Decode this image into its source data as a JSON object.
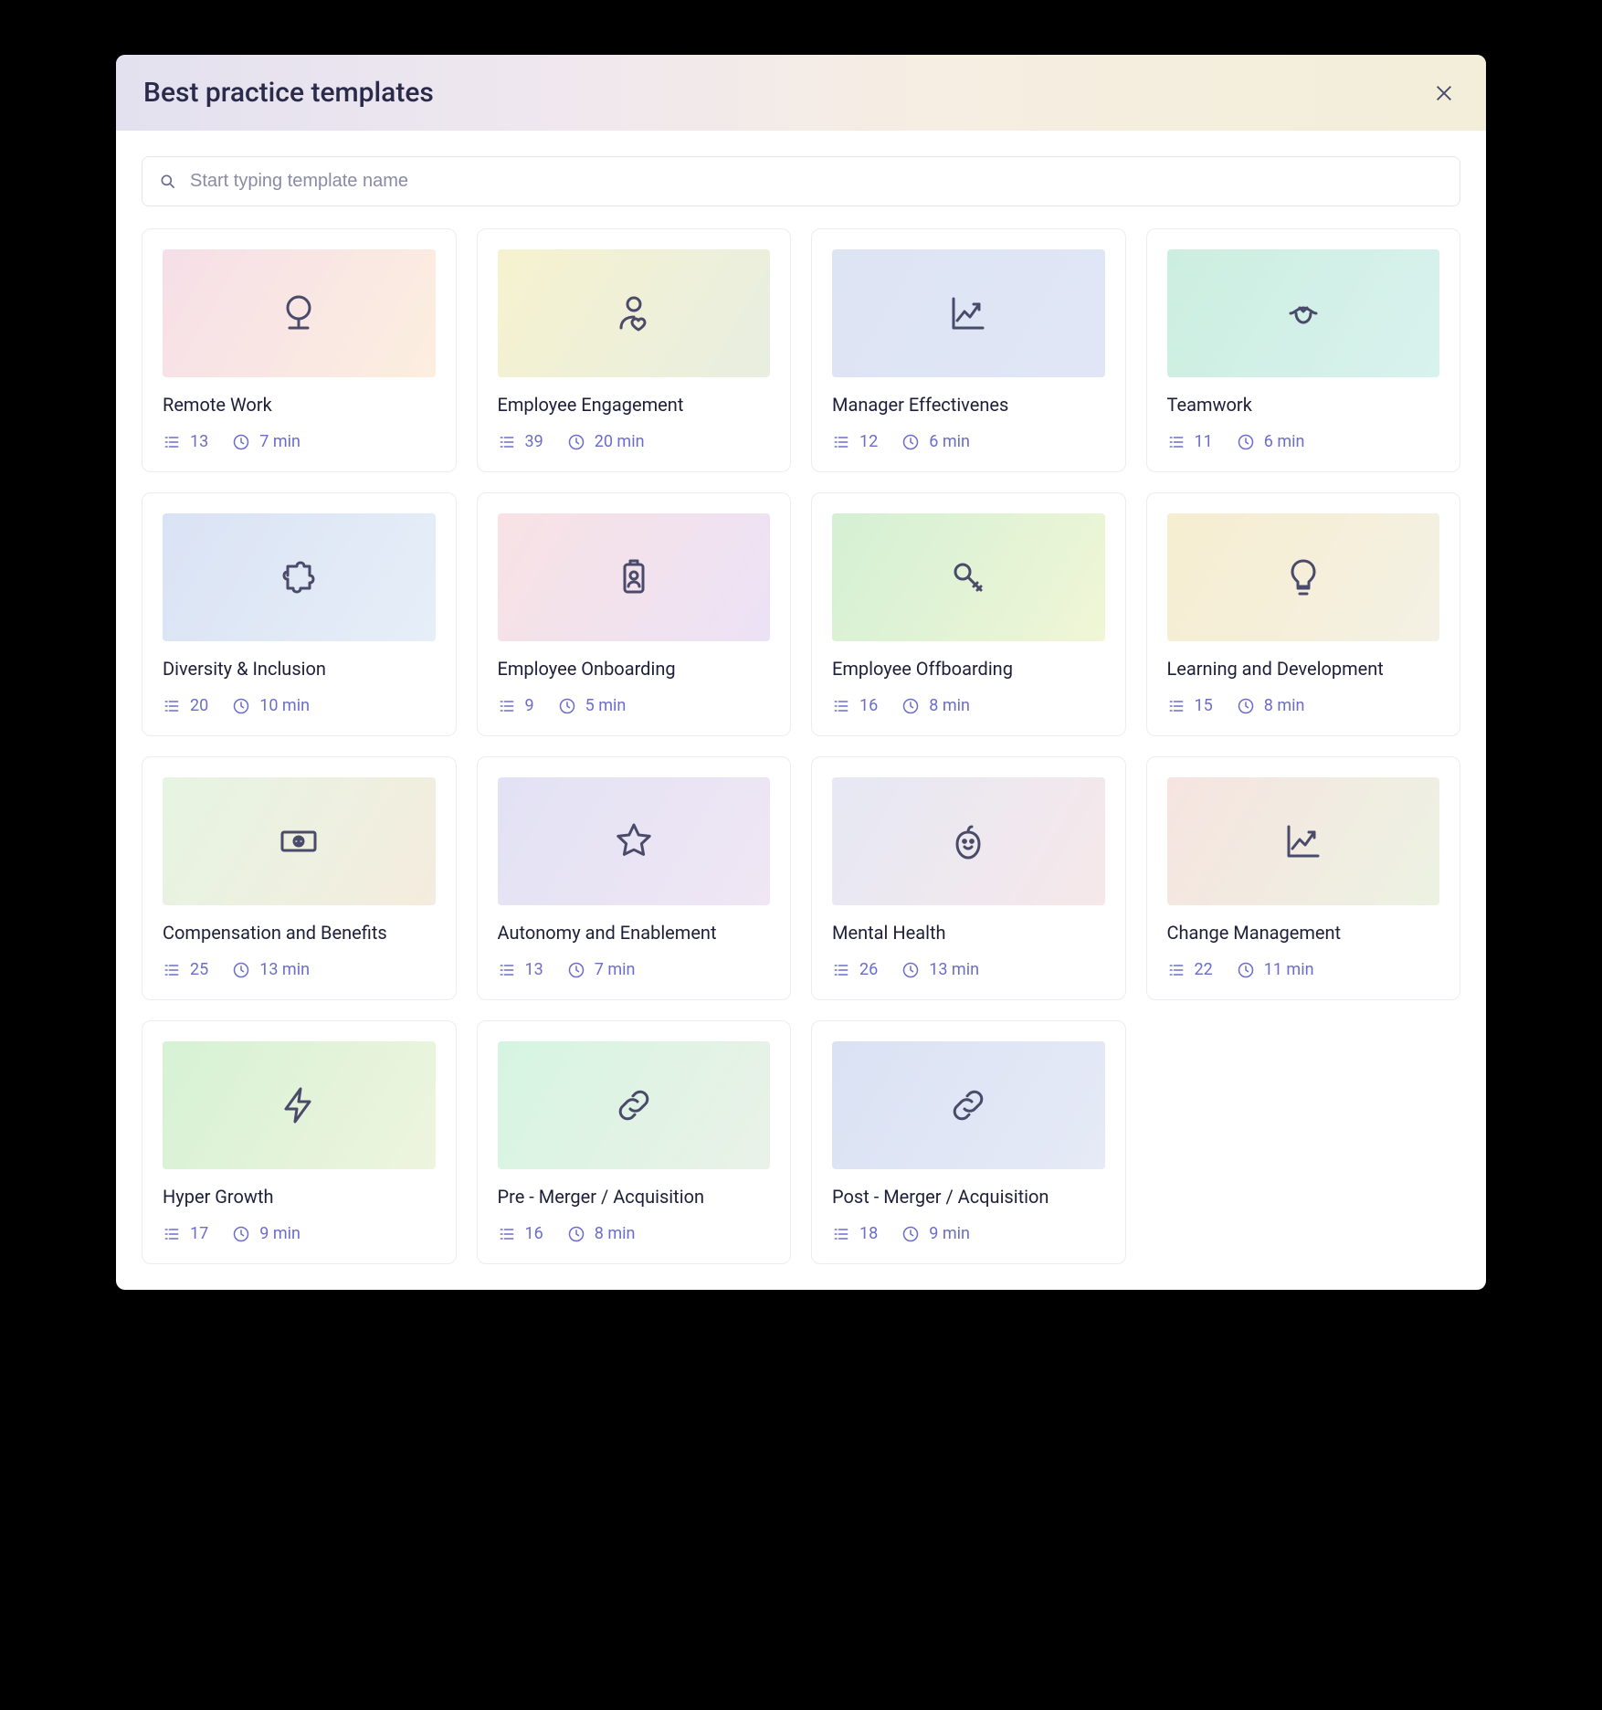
{
  "modal": {
    "title": "Best practice templates"
  },
  "search": {
    "placeholder": "Start typing template name",
    "value": ""
  },
  "templates": [
    {
      "title": "Remote Work",
      "questions": "13",
      "duration": "7 min",
      "icon": "globe-stand-icon",
      "gradient": "g0"
    },
    {
      "title": "Employee Engagement",
      "questions": "39",
      "duration": "20 min",
      "icon": "person-heart-icon",
      "gradient": "g1"
    },
    {
      "title": "Manager Effectivenes",
      "questions": "12",
      "duration": "6 min",
      "icon": "growth-chart-icon",
      "gradient": "g2"
    },
    {
      "title": "Teamwork",
      "questions": "11",
      "duration": "6 min",
      "icon": "handshake-icon",
      "gradient": "g3"
    },
    {
      "title": "Diversity & Inclusion",
      "questions": "20",
      "duration": "10 min",
      "icon": "puzzle-piece-icon",
      "gradient": "g4"
    },
    {
      "title": "Employee Onboarding",
      "questions": "9",
      "duration": "5 min",
      "icon": "id-badge-icon",
      "gradient": "g5"
    },
    {
      "title": "Employee Offboarding",
      "questions": "16",
      "duration": "8 min",
      "icon": "key-icon",
      "gradient": "g6"
    },
    {
      "title": "Learning and Development",
      "questions": "15",
      "duration": "8 min",
      "icon": "lightbulb-icon",
      "gradient": "g7"
    },
    {
      "title": "Compensation and Benefits",
      "questions": "25",
      "duration": "13 min",
      "icon": "money-bill-icon",
      "gradient": "g8"
    },
    {
      "title": "Autonomy and Enablement",
      "questions": "13",
      "duration": "7 min",
      "icon": "star-icon",
      "gradient": "g9"
    },
    {
      "title": "Mental Health",
      "questions": "26",
      "duration": "13 min",
      "icon": "apple-face-icon",
      "gradient": "g10"
    },
    {
      "title": "Change Management",
      "questions": "22",
      "duration": "11 min",
      "icon": "growth-chart-icon",
      "gradient": "g11"
    },
    {
      "title": "Hyper Growth",
      "questions": "17",
      "duration": "9 min",
      "icon": "lightning-icon",
      "gradient": "g12"
    },
    {
      "title": "Pre - Merger / Acquisition",
      "questions": "16",
      "duration": "8 min",
      "icon": "link-icon",
      "gradient": "g13"
    },
    {
      "title": "Post - Merger / Acquisition",
      "questions": "18",
      "duration": "9 min",
      "icon": "link-icon",
      "gradient": "g14"
    }
  ]
}
